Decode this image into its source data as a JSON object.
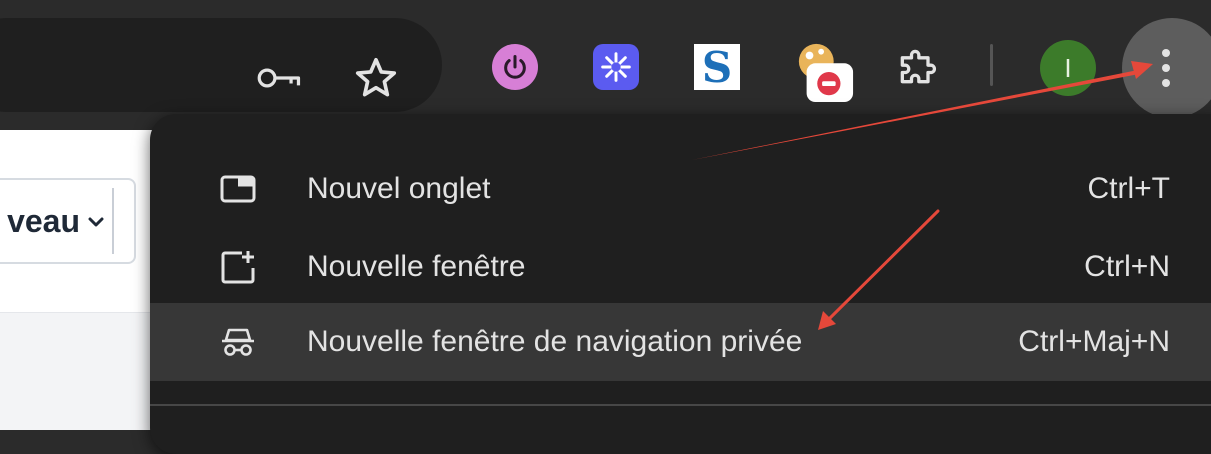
{
  "toolbar": {
    "omnibox_icons": [
      "key-icon",
      "star-icon"
    ],
    "extensions": [
      {
        "name": "power-extension-icon",
        "color": "#d77fd6"
      },
      {
        "name": "sparkle-extension-icon",
        "color": "#5b5bf0"
      },
      {
        "name": "s-extension-icon",
        "color": "#1d6fb8"
      },
      {
        "name": "blocked-extension-icon",
        "color": "#e0384a"
      },
      {
        "name": "puzzle-extensions-icon",
        "color": "#c4c4c4"
      }
    ],
    "avatar_letter": "I",
    "avatar_color": "#3c7b2a",
    "menu_button_icon": "more-vertical-icon"
  },
  "page": {
    "select_text": "veau"
  },
  "menu": {
    "items": [
      {
        "label": "Nouvel onglet",
        "shortcut": "Ctrl+T",
        "icon": "new-tab-icon",
        "highlighted": false
      },
      {
        "label": "Nouvelle fenêtre",
        "shortcut": "Ctrl+N",
        "icon": "new-window-icon",
        "highlighted": false
      },
      {
        "label": "Nouvelle fenêtre de navigation privée",
        "shortcut": "Ctrl+Maj+N",
        "icon": "incognito-icon",
        "highlighted": true
      }
    ]
  },
  "colors": {
    "toolbar_bg": "#2b2b2b",
    "menu_bg": "#1f1f1f",
    "menu_highlight": "#373737",
    "annotation_arrow": "#e5483a"
  }
}
